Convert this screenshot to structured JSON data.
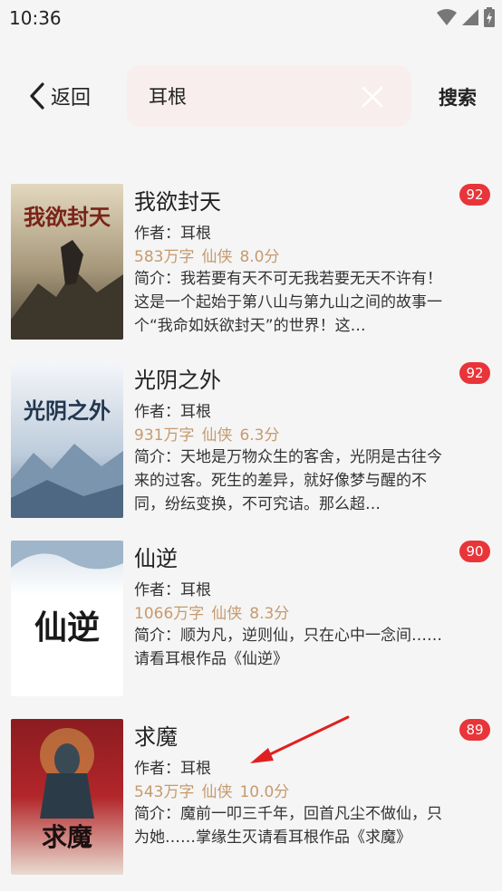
{
  "status_bar": {
    "time": "10:36"
  },
  "top_bar": {
    "back_label": "返回",
    "search_value": "耳根",
    "search_button": "搜索"
  },
  "books": [
    {
      "title": "我欲封天",
      "author": "作者：耳根",
      "words": "583万字",
      "genre": "仙侠",
      "score": "8.0分",
      "badge": "92",
      "desc": "简介：我若要有天不可无我若要无天不许有！这是一个起始于第八山与第九山之间的故事一个“我命如妖欲封天”的世界！这…",
      "cover_text": "我欲封天",
      "cover_colors": [
        "#d8cdb4",
        "#8a7a5e",
        "#3c352a"
      ]
    },
    {
      "title": "光阴之外",
      "author": "作者：耳根",
      "words": "931万字",
      "genre": "仙侠",
      "score": "6.3分",
      "badge": "92",
      "desc": "简介：天地是万物众生的客舍，光阴是古往今来的过客。死生的差异，就好像梦与醒的不同，纷纭变换，不可究诘。那么超…",
      "cover_text": "光阴之外",
      "cover_colors": [
        "#f2f5f8",
        "#9fb6cd",
        "#4a6a8a"
      ]
    },
    {
      "title": "仙逆",
      "author": "作者：耳根",
      "words": "1066万字",
      "genre": "仙侠",
      "score": "8.3分",
      "badge": "90",
      "desc": "简介：顺为凡，逆则仙，只在心中一念间……请看耳根作品《仙逆》",
      "cover_text": "仙逆",
      "cover_colors": [
        "#ffffff",
        "#c9d6e3",
        "#6d8aa8"
      ]
    },
    {
      "title": "求魔",
      "author": "作者：耳根",
      "words": "543万字",
      "genre": "仙侠",
      "score": "10.0分",
      "badge": "89",
      "desc": "简介：魔前一叩三千年，回首凡尘不做仙，只为她……掌缘生灭请看耳根作品《求魔》",
      "cover_text": "求魔",
      "cover_colors": [
        "#b3262a",
        "#6b1418",
        "#e0b25c"
      ]
    }
  ],
  "accent": "#e8353a",
  "meta_color": "#c69a6e"
}
